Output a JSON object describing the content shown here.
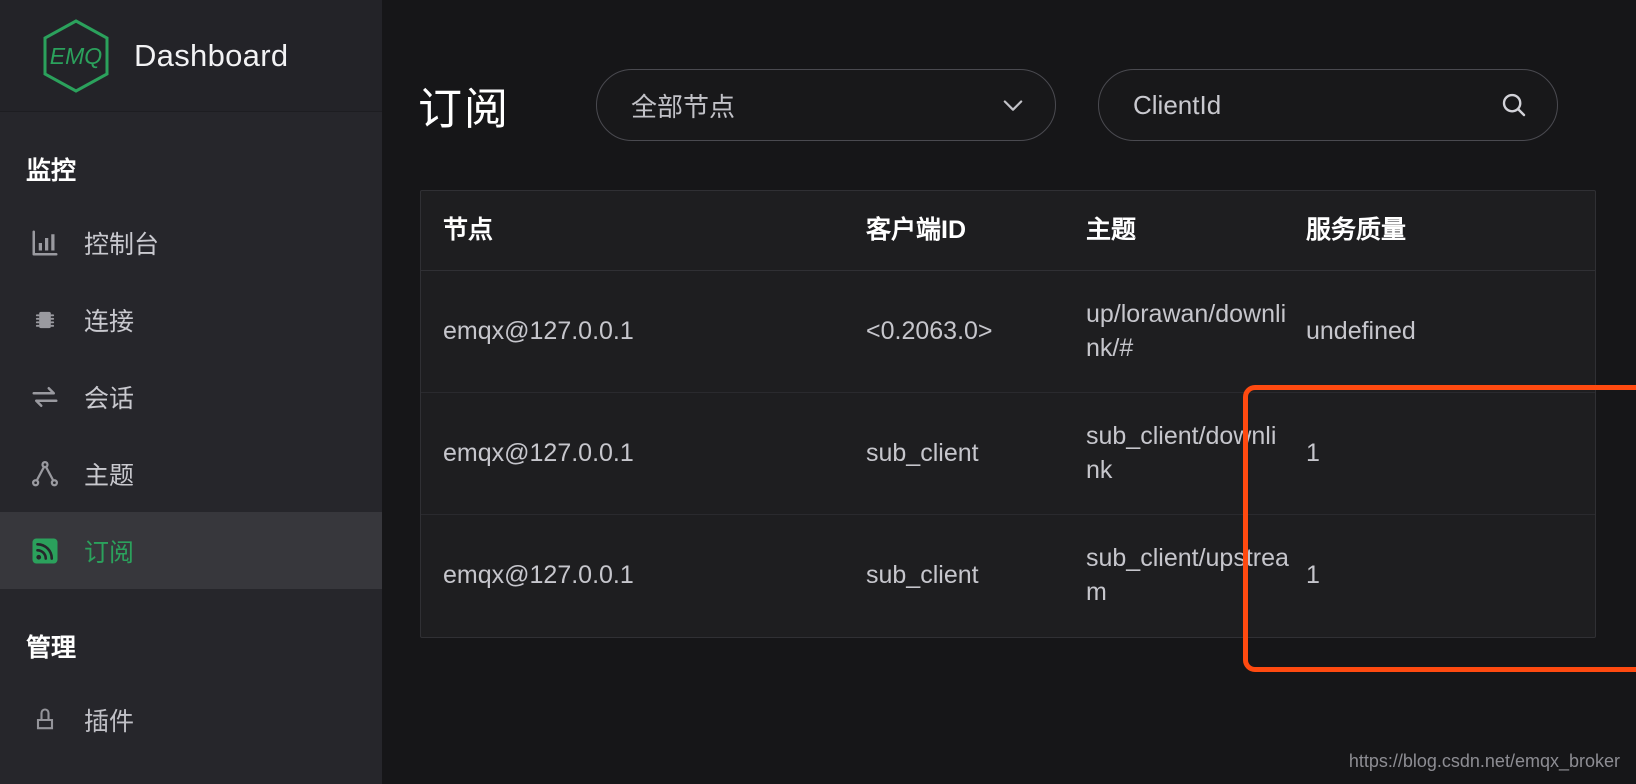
{
  "brand": {
    "logo_text": "EMQ",
    "title": "Dashboard",
    "accent_color": "#2ba15c"
  },
  "sidebar": {
    "sections": [
      {
        "title": "监控",
        "items": [
          {
            "label": "控制台",
            "icon": "bar-chart-icon",
            "active": false
          },
          {
            "label": "连接",
            "icon": "chip-icon",
            "active": false
          },
          {
            "label": "会话",
            "icon": "exchange-icon",
            "active": false
          },
          {
            "label": "主题",
            "icon": "share-nodes-icon",
            "active": false
          },
          {
            "label": "订阅",
            "icon": "rss-icon",
            "active": true
          }
        ]
      },
      {
        "title": "管理",
        "items": [
          {
            "label": "插件",
            "icon": "plugin-icon",
            "active": false
          }
        ]
      }
    ]
  },
  "header": {
    "page_title": "订阅",
    "node_select": {
      "value": "全部节点",
      "chevron_icon": "chevron-down-icon"
    },
    "search": {
      "value": "",
      "placeholder": "ClientId",
      "icon": "search-icon"
    }
  },
  "table": {
    "columns": [
      "节点",
      "客户端ID",
      "主题",
      "服务质量"
    ],
    "rows": [
      {
        "node": "emqx@127.0.0.1",
        "client_id": "<0.2063.0>",
        "topic": "up/lorawan/downlink/#",
        "qos": "undefined",
        "highlighted": false
      },
      {
        "node": "emqx@127.0.0.1",
        "client_id": "sub_client",
        "topic": "sub_client/downlink",
        "qos": "1",
        "highlighted": true
      },
      {
        "node": "emqx@127.0.0.1",
        "client_id": "sub_client",
        "topic": "sub_client/upstream",
        "qos": "1",
        "highlighted": true
      }
    ]
  },
  "annotation": {
    "highlight_color": "#FF4A10"
  },
  "watermark": "https://blog.csdn.net/emqx_broker"
}
